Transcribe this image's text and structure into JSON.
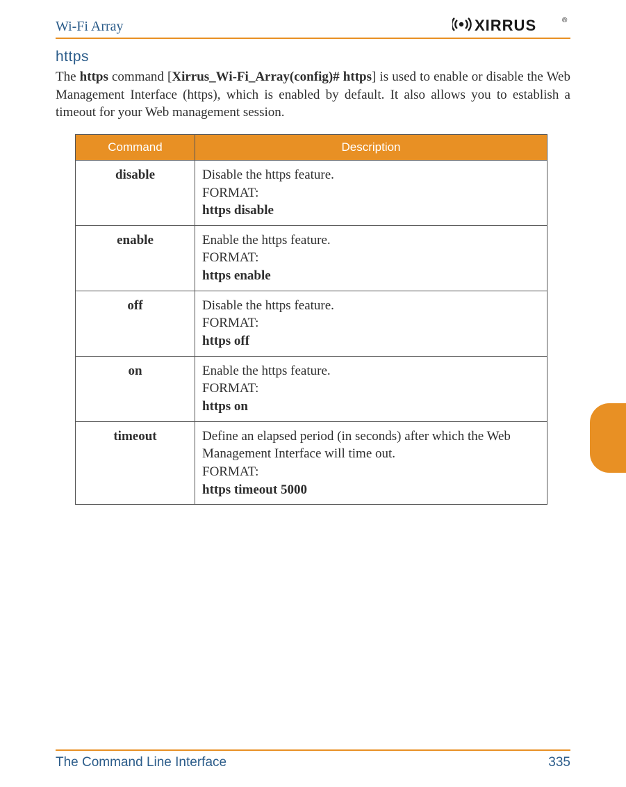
{
  "header": {
    "title": "Wi-Fi Array",
    "logo_text": "XIRRUS",
    "logo_reg": "®"
  },
  "section": {
    "title": "https",
    "intro_pre": "The ",
    "cmd": "https",
    "intro_mid1": " command [",
    "prompt": "Xirrus_Wi-Fi_Array(config)# https",
    "intro_mid2": "] is used to enable or disable the Web Management Interface (https), which is enabled by default. It also allows you to establish a timeout for your Web management session."
  },
  "table": {
    "head_command": "Command",
    "head_description": "Description",
    "rows": [
      {
        "cmd": "disable",
        "desc": "Disable the https feature.",
        "format_label": "FORMAT:",
        "format": "https disable"
      },
      {
        "cmd": "enable",
        "desc": "Enable the https feature.",
        "format_label": "FORMAT:",
        "format": "https enable"
      },
      {
        "cmd": "off",
        "desc": "Disable the https feature.",
        "format_label": "FORMAT:",
        "format": "https off"
      },
      {
        "cmd": "on",
        "desc": "Enable the https feature.",
        "format_label": "FORMAT:",
        "format": "https on"
      },
      {
        "cmd": "timeout",
        "desc": "Define an elapsed period (in seconds) after which the Web Management Interface will time out.",
        "format_label": "FORMAT:",
        "format": "https timeout 5000"
      }
    ]
  },
  "footer": {
    "left": "The Command Line Interface",
    "right": "335"
  }
}
